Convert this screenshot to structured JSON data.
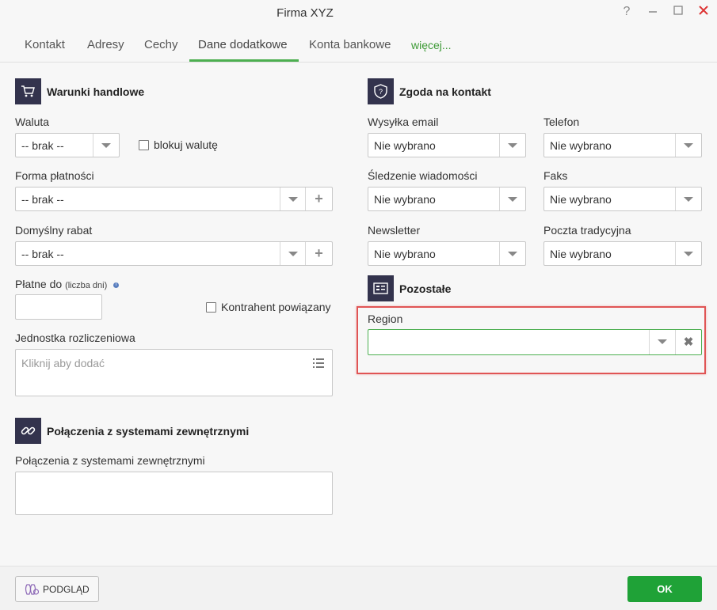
{
  "window": {
    "title": "Firma XYZ",
    "help": "?",
    "minimize": "—",
    "maximize": "☐",
    "close": "✕"
  },
  "tabs": [
    {
      "label": "Kontakt"
    },
    {
      "label": "Adresy"
    },
    {
      "label": "Cechy"
    },
    {
      "label": "Dane dodatkowe",
      "active": true
    },
    {
      "label": "Konta bankowe"
    },
    {
      "label": "więcej..."
    }
  ],
  "left": {
    "warunki": {
      "title": "Warunki handlowe",
      "waluta_label": "Waluta",
      "waluta_value": "-- brak --",
      "blokuj_label": "blokuj walutę",
      "forma_label": "Forma płatności",
      "forma_value": "-- brak --",
      "rabat_label": "Domyślny rabat",
      "rabat_value": "-- brak --",
      "platne_label": "Płatne do",
      "platne_hint": "(liczba dni)",
      "platne_value": "",
      "powiazany_label": "Kontrahent powiązany",
      "jednostka_label": "Jednostka rozliczeniowa",
      "jednostka_placeholder": "Kliknij aby dodać"
    },
    "polaczenia": {
      "title": "Połączenia z systemami zewnętrznymi",
      "field_label": "Połączenia z systemami zewnętrznymi"
    }
  },
  "right": {
    "zgoda": {
      "title": "Zgoda na kontakt",
      "wysylka_label": "Wysyłka email",
      "wysylka_value": "Nie wybrano",
      "telefon_label": "Telefon",
      "telefon_value": "Nie wybrano",
      "sledzenie_label": "Śledzenie wiadomości",
      "sledzenie_value": "Nie wybrano",
      "faks_label": "Faks",
      "faks_value": "Nie wybrano",
      "newsletter_label": "Newsletter",
      "newsletter_value": "Nie wybrano",
      "poczta_label": "Poczta tradycyjna",
      "poczta_value": "Nie wybrano"
    },
    "pozostale": {
      "title": "Pozostałe",
      "region_label": "Region",
      "region_value": ""
    }
  },
  "footer": {
    "preview_label": "PODGLĄD",
    "ok_label": "OK"
  },
  "colors": {
    "accent": "#4caf50",
    "ok": "#1fa237",
    "icon_bg": "#33334d",
    "highlight": "#e05555"
  }
}
